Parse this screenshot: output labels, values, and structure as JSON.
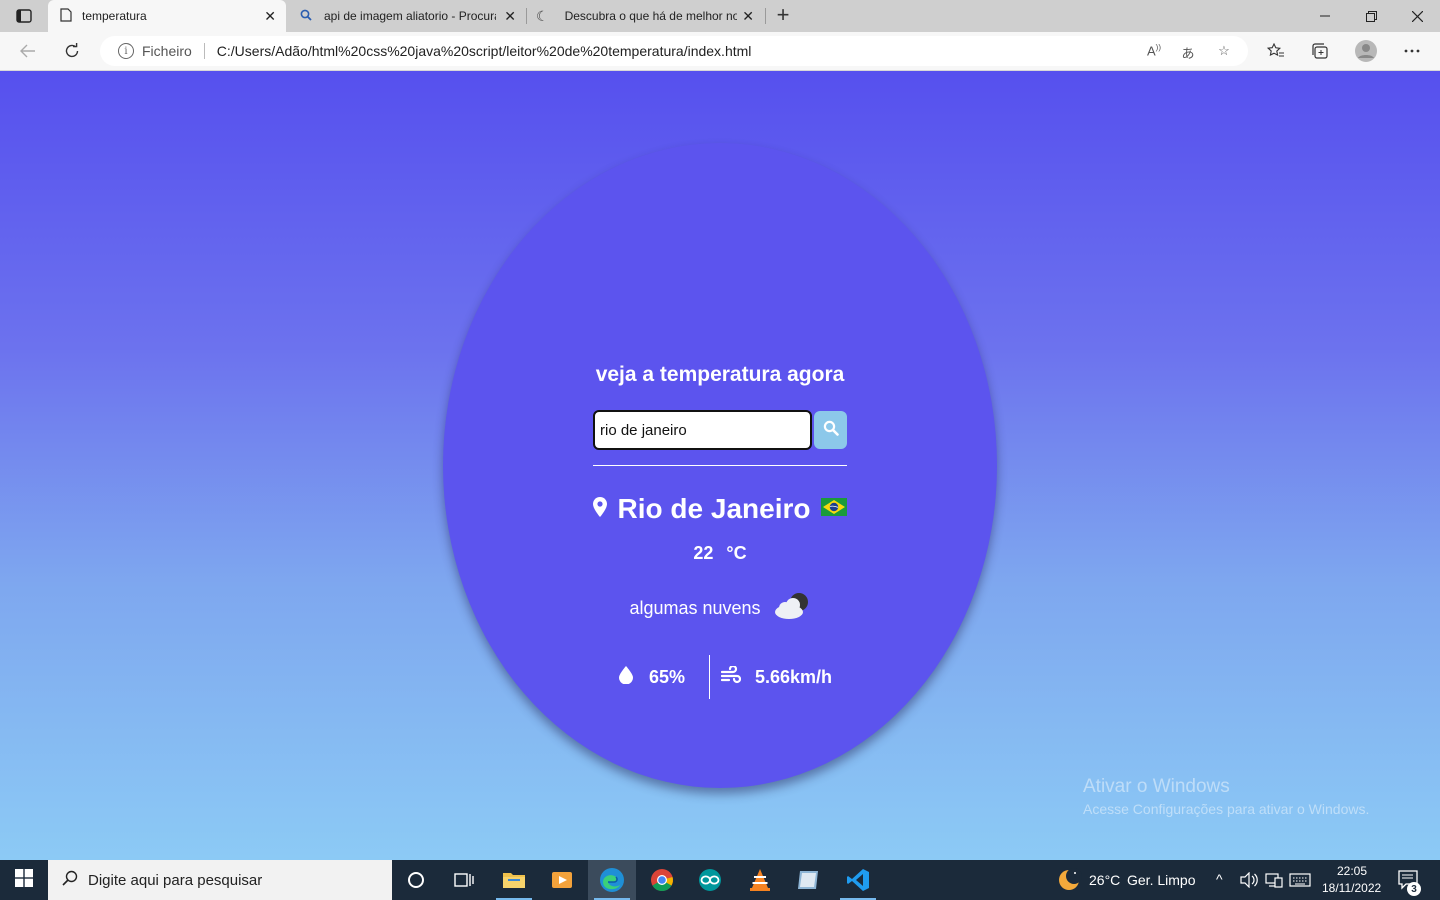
{
  "browser": {
    "tabs": [
      {
        "title": "temperatura",
        "active": true
      },
      {
        "title": "api de imagem aliatorio - Procurar",
        "active": false
      },
      {
        "title": "Descubra o que há de melhor no",
        "active": false
      }
    ],
    "address": {
      "scheme_label": "Ficheiro",
      "url": "C:/Users/Adão/html%20css%20java%20script/leitor%20de%20temperatura/index.html"
    }
  },
  "app": {
    "title": "veja a temperatura agora",
    "search_value": "rio de janeiro",
    "city": "Rio de Janeiro",
    "temperature": "22",
    "unit": "°C",
    "description": "algumas nuvens",
    "humidity": "65%",
    "wind": "5.66km/h"
  },
  "watermark": {
    "line1": "Ativar o Windows",
    "line2": "Acesse Configurações para ativar o Windows."
  },
  "taskbar": {
    "search_placeholder": "Digite aqui para pesquisar",
    "weather_temp": "26°C",
    "weather_desc": "Ger. Limpo",
    "time": "22:05",
    "date": "18/11/2022",
    "notification_count": "3"
  }
}
